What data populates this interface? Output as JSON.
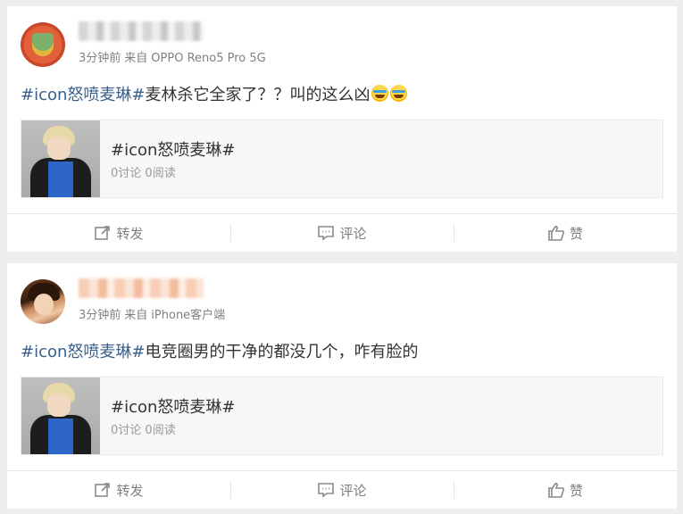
{
  "posts": [
    {
      "meta_time": "3分钟前",
      "meta_from": "来自",
      "meta_device": "OPPO Reno5 Pro 5G",
      "tag": "#icon怒喷麦琳#",
      "text": "麦林杀它全家了？？叫的这么凶",
      "emoji_icons": [
        "laugh-cry-icon",
        "laugh-cry-icon"
      ],
      "link_card": {
        "title": "#icon怒喷麦琳#",
        "discuss": "0讨论",
        "reads": "0阅读"
      },
      "actions": {
        "repost": "转发",
        "comment": "评论",
        "like": "赞"
      }
    },
    {
      "meta_time": "3分钟前",
      "meta_from": "来自",
      "meta_device": "iPhone客户端",
      "tag": "#icon怒喷麦琳#",
      "text": "电竞圈男的干净的都没几个，咋有脸的",
      "link_card": {
        "title": "#icon怒喷麦琳#",
        "discuss": "0讨论",
        "reads": "0阅读"
      },
      "actions": {
        "repost": "转发",
        "comment": "评论",
        "like": "赞"
      }
    }
  ]
}
